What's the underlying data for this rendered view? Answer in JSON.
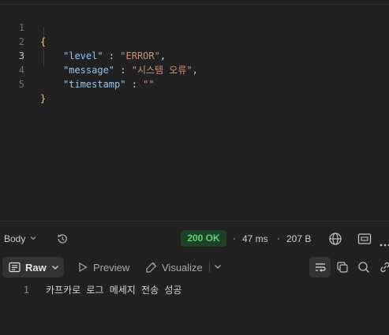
{
  "editor": {
    "line_numbers": [
      "1",
      "2",
      "3",
      "4",
      "5"
    ],
    "open_brace": "{",
    "close_brace": "}",
    "entries": [
      {
        "key": "\"level\"",
        "sep": " : ",
        "value": "\"ERROR\"",
        "trail": ","
      },
      {
        "key": "\"message\"",
        "sep": " : ",
        "value": "\"시스템 오류\"",
        "trail": ","
      },
      {
        "key": "\"timestamp\"",
        "sep": " : ",
        "value": "\"\"",
        "trail": ""
      }
    ]
  },
  "response_meta": {
    "body_label": "Body",
    "status": "200 OK",
    "time": "47 ms",
    "size": "207 B"
  },
  "response_toolbar": {
    "raw_label": "Raw",
    "preview_label": "Preview",
    "visualize_label": "Visualize"
  },
  "response_body": {
    "line_number": "1",
    "text": "카프카로 로그 메세지 전송 성공"
  },
  "colors": {
    "status_bg": "#1e4226",
    "status_text": "#5fd07a",
    "key": "#8fc6f5",
    "string": "#ce9178"
  },
  "icons": [
    "history-icon",
    "globe-icon",
    "save-response-icon",
    "more-icon",
    "raw-icon",
    "play-icon",
    "visualize-icon",
    "chevron-down-icon",
    "wrap-icon",
    "copy-icon",
    "search-icon",
    "link-icon"
  ]
}
